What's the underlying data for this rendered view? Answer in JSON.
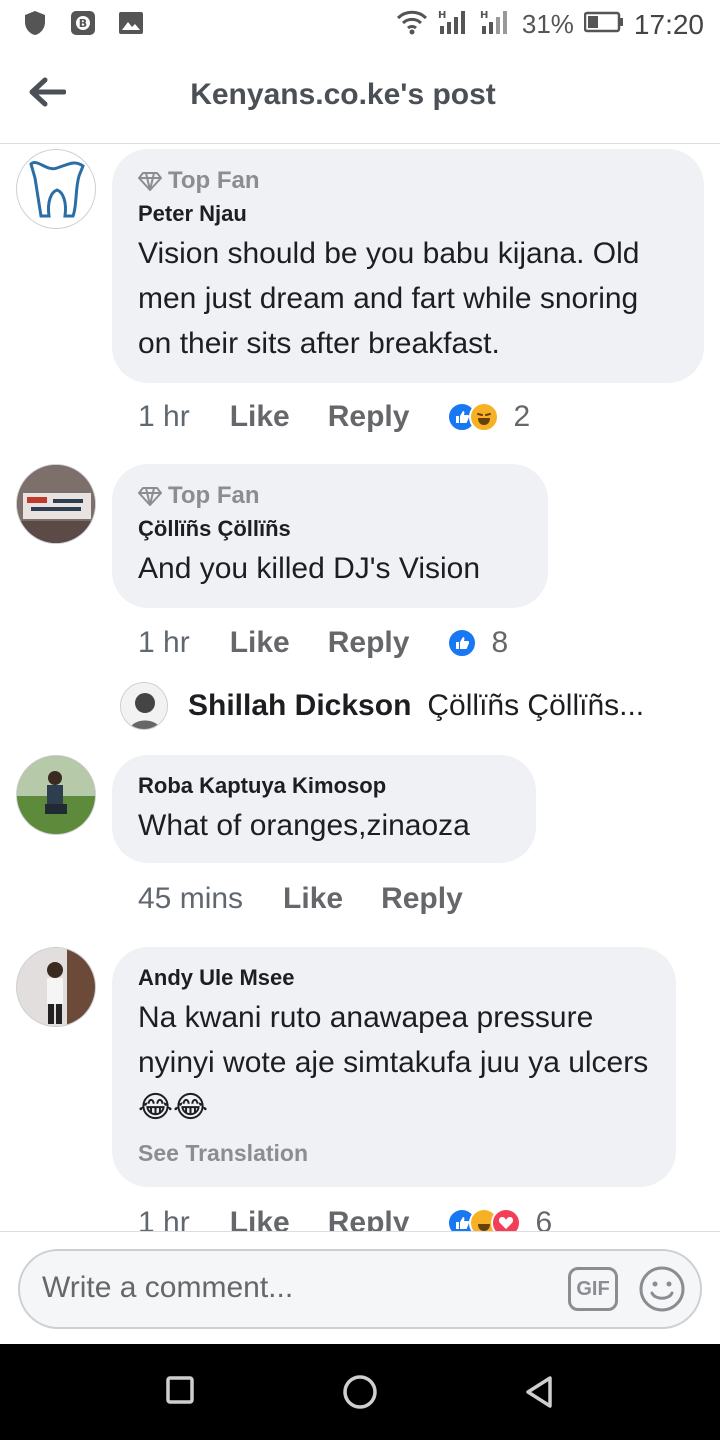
{
  "status_bar": {
    "battery_percent": "31%",
    "time": "17:20",
    "left_icons": [
      "shield-icon",
      "vpn-key-icon",
      "image-icon"
    ],
    "right_icons": [
      "wifi-icon",
      "signal-h-icon",
      "signal-h-icon",
      "battery-icon"
    ]
  },
  "header": {
    "title": "Kenyans.co.ke's post",
    "back_icon": "arrow-left-icon"
  },
  "comments": [
    {
      "badge": "Top Fan",
      "author": "Peter Njau",
      "text": "Vision should be you babu kijana. Old men just dream and fart while snoring on their sits after breakfast.",
      "time": "1 hr",
      "like": "Like",
      "reply": "Reply",
      "reactions": [
        "like",
        "haha"
      ],
      "reaction_count": "2"
    },
    {
      "badge": "Top Fan",
      "author": "Çöllïñs Çöllïñs",
      "text": "And you killed DJ's Vision",
      "time": "1 hr",
      "like": "Like",
      "reply": "Reply",
      "reactions": [
        "like"
      ],
      "reaction_count": "8",
      "reply_preview": {
        "name": "Shillah Dickson",
        "text": "Çöllïñs Çöllïñs..."
      }
    },
    {
      "author": "Roba Kaptuya Kimosop",
      "text": "What of oranges,zinaoza",
      "time": "45 mins",
      "like": "Like",
      "reply": "Reply"
    },
    {
      "author": "Andy Ule Msee",
      "text": "Na kwani ruto anawapea pressure nyinyi wote aje simtakufa juu ya ulcers😂😂",
      "see_translation": "See Translation",
      "time": "1 hr",
      "like": "Like",
      "reply": "Reply",
      "reactions": [
        "like",
        "haha",
        "love"
      ],
      "reaction_count": "6"
    }
  ],
  "composer": {
    "placeholder": "Write a comment...",
    "gif_label": "GIF"
  },
  "colors": {
    "like_blue": "#1877f2",
    "love_red": "#f33e58",
    "haha_yellow": "#f7b125",
    "bubble_bg": "#f0f1f4"
  }
}
